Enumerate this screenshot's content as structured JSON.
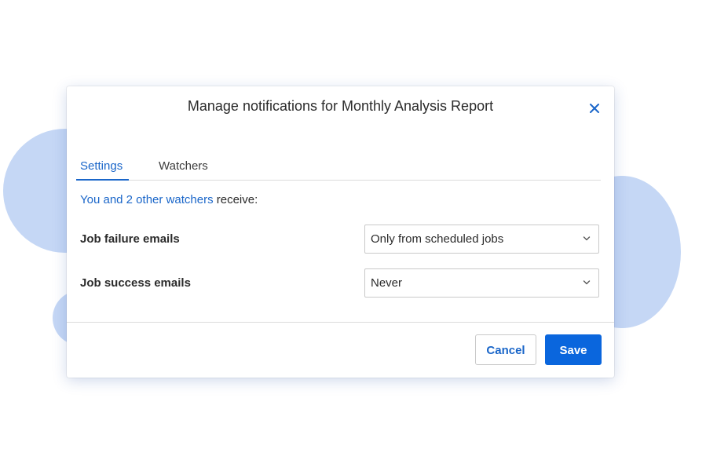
{
  "dialog": {
    "title": "Manage notifications for Monthly Analysis Report",
    "close_icon": "close-icon"
  },
  "tabs": [
    {
      "label": "Settings",
      "active": true
    },
    {
      "label": "Watchers",
      "active": false
    }
  ],
  "watchers": {
    "link_text": "You and 2 other watchers",
    "suffix": " receive:"
  },
  "settings": {
    "job_failure": {
      "label": "Job failure emails",
      "value": "Only from scheduled jobs"
    },
    "job_success": {
      "label": "Job success emails",
      "value": "Never"
    }
  },
  "footer": {
    "cancel_label": "Cancel",
    "save_label": "Save"
  },
  "colors": {
    "accent": "#1a66c9",
    "primary_button": "#0a66dd",
    "background_blob": "#c5d7f5"
  }
}
